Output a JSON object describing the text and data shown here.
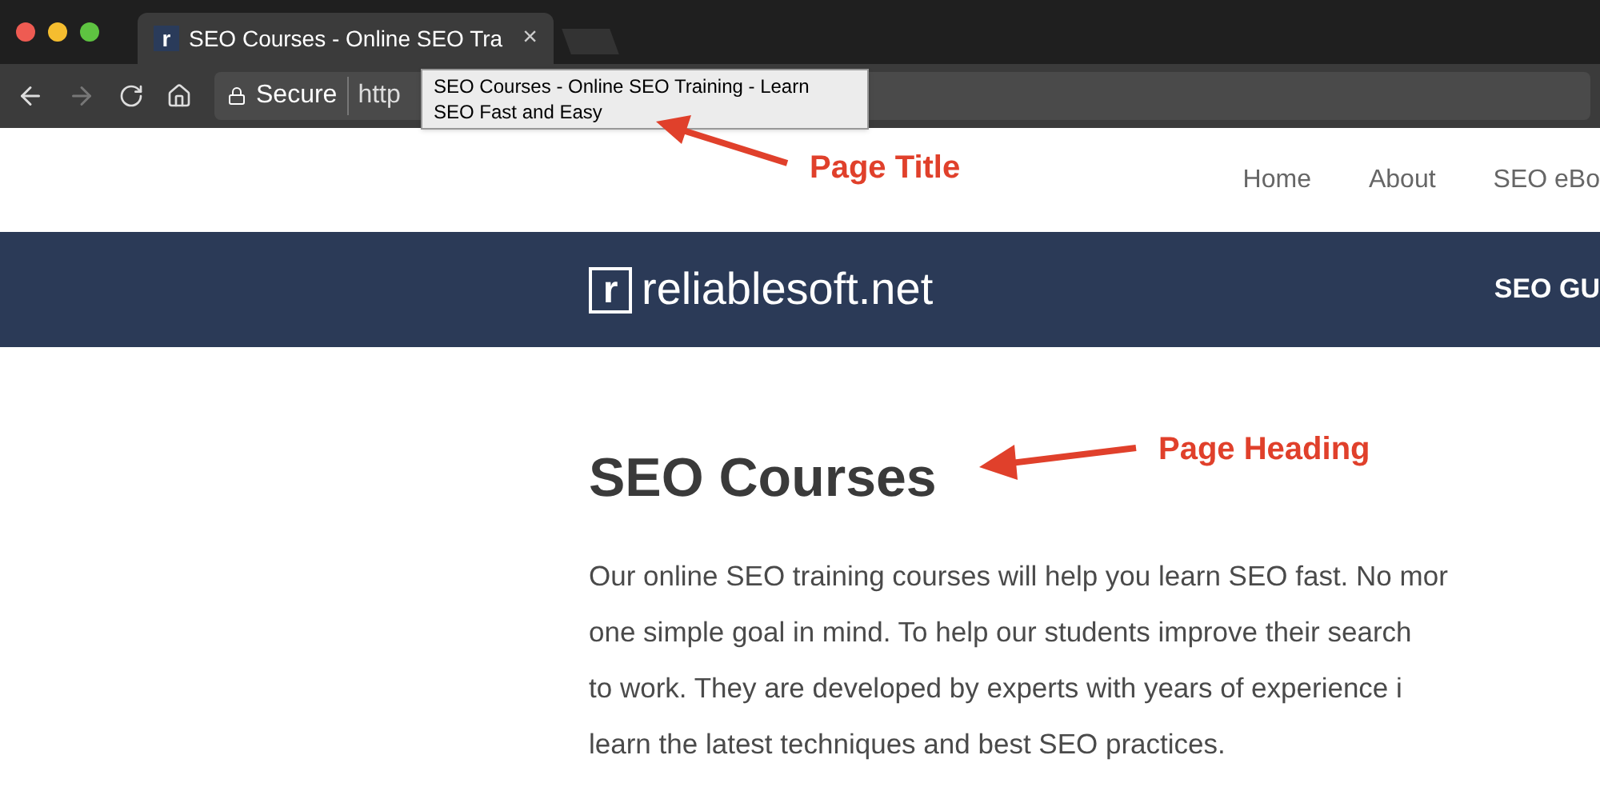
{
  "browser": {
    "tab": {
      "favicon": "r",
      "title": "SEO Courses - Online SEO Tra",
      "close": "×"
    },
    "address": {
      "secure_label": "Secure",
      "url": "http"
    },
    "tooltip": [
      "SEO Courses - Online SEO Training - Learn",
      "SEO Fast and Easy"
    ]
  },
  "site": {
    "nav": [
      "Home",
      "About",
      "SEO eBo"
    ],
    "logo": {
      "mark": "r",
      "name": "reliablesoft.net"
    },
    "banner_menu": "SEO GU"
  },
  "content": {
    "heading": "SEO Courses",
    "lines": [
      "Our online SEO training courses will help you learn SEO fast. No mor",
      "one simple goal in mind. To help our students improve their search",
      "to work. They are developed by experts with years of experience i",
      "learn the latest techniques and best SEO practices."
    ]
  },
  "annotations": [
    {
      "kind": "title",
      "label": "Page Title"
    },
    {
      "kind": "heading",
      "label": "Page Heading"
    }
  ]
}
